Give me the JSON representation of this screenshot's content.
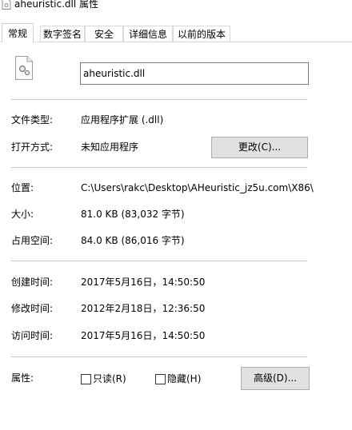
{
  "window": {
    "title": "aheuristic.dll 属性"
  },
  "tabs": [
    {
      "label": "常规",
      "active": true
    },
    {
      "label": "数字签名",
      "active": false
    },
    {
      "label": "安全",
      "active": false
    },
    {
      "label": "详细信息",
      "active": false
    },
    {
      "label": "以前的版本",
      "active": false
    }
  ],
  "general": {
    "filename": "aheuristic.dll",
    "file_type_label": "文件类型:",
    "file_type_value": "应用程序扩展 (.dll)",
    "opens_with_label": "打开方式:",
    "opens_with_value": "未知应用程序",
    "change_button": "更改(C)...",
    "location_label": "位置:",
    "location_value": "C:\\Users\\rakc\\Desktop\\AHeuristic_jz5u.com\\X86\\",
    "size_label": "大小:",
    "size_value": "81.0 KB (83,032 字节)",
    "size_on_disk_label": "占用空间:",
    "size_on_disk_value": "84.0 KB (86,016 字节)",
    "created_label": "创建时间:",
    "created_value": "2017年5月16日，14:50:50",
    "modified_label": "修改时间:",
    "modified_value": "2012年2月18日，12:36:50",
    "accessed_label": "访问时间:",
    "accessed_value": "2017年5月16日，14:50:50",
    "attributes_label": "属性:",
    "readonly_label": "只读(R)",
    "readonly_checked": false,
    "hidden_label": "隐藏(H)",
    "hidden_checked": false,
    "advanced_button": "高级(D)..."
  },
  "icons": {
    "title_icon": "dll-file-icon",
    "file_icon": "dll-file-gear-icon"
  }
}
